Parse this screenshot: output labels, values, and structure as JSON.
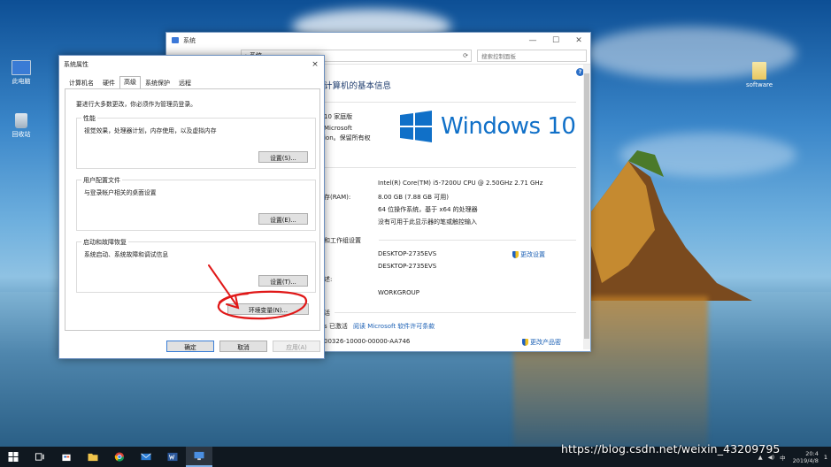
{
  "desktop": {
    "icons": [
      {
        "label": "此电脑"
      },
      {
        "label": "回收站"
      },
      {
        "label": "software"
      }
    ]
  },
  "system_window": {
    "title": "系统",
    "breadcrumb_tail": "系统",
    "search_placeholder": "搜索控制面板",
    "heading": "计算机的基本信息",
    "edition_partial": "10 家庭版",
    "copyright_line1": "Microsoft",
    "copyright_line2": "ion。保留所有权",
    "logo_text": "Windows 10",
    "processor": "Intel(R) Core(TM) i5-7200U CPU @ 2.50GHz   2.71 GHz",
    "ram_label": "存(RAM):",
    "ram_value": "8.00 GB (7.88 GB 可用)",
    "system_type": "64 位操作系统，基于 x64 的处理器",
    "pen_touch": "没有可用于此显示器的笔或触控输入",
    "section_computer_name": "和工作组设置",
    "computer_name": "DESKTOP-2735EVS",
    "full_computer_name": "DESKTOP-2735EVS",
    "desc_label_partial": "述:",
    "workgroup": "WORKGROUP",
    "change_settings": "更改设置",
    "activation_section_partial": "活",
    "activation_status_partial": "s 已激活",
    "license_link": "阅读 Microsoft 软件许可条款",
    "product_id_partial": "00326-10000-00000-AA746",
    "change_key": "更改产品密"
  },
  "dialog": {
    "title": "系统属性",
    "close_glyph": "×",
    "tabs": [
      {
        "label": "计算机名"
      },
      {
        "label": "硬件"
      },
      {
        "label": "高级"
      },
      {
        "label": "系统保护"
      },
      {
        "label": "远程"
      }
    ],
    "intro": "要进行大多数更改，你必须作为管理员登录。",
    "performance": {
      "label": "性能",
      "desc": "视觉效果，处理器计划，内存使用，以及虚拟内存",
      "button": "设置(S)..."
    },
    "user_profiles": {
      "label": "用户配置文件",
      "desc": "与登录帐户相关的桌面设置",
      "button": "设置(E)..."
    },
    "startup_recovery": {
      "label": "启动和故障恢复",
      "desc": "系统启动、系统故障和调试信息",
      "button": "设置(T)..."
    },
    "env_button": "环境变量(N)...",
    "ok_button": "确定",
    "cancel_button": "取消",
    "apply_button": "应用(A)"
  },
  "taskbar": {
    "clock_time": "20:4",
    "clock_date": "2019/4/8",
    "tray_text": "中",
    "notification_count": "1"
  },
  "watermark": "https://blog.csdn.net/weixin_43209795",
  "colors": {
    "accent": "#1070c8",
    "annotation_red": "#e01818",
    "taskbar": "#101820"
  }
}
